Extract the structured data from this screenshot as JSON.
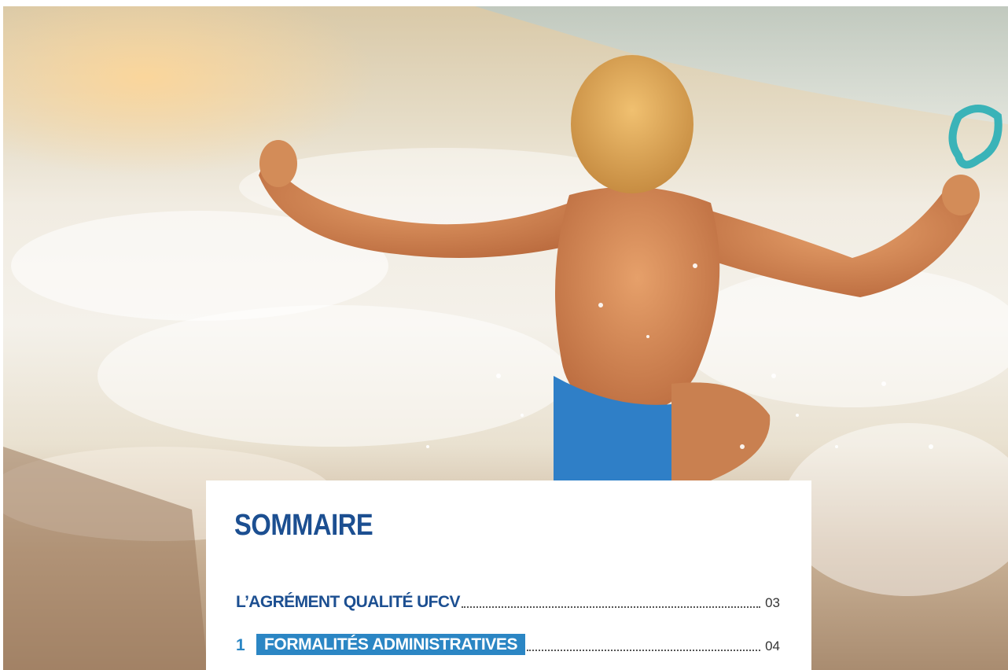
{
  "toc": {
    "title": "SOMMAIRE",
    "entries": [
      {
        "number": "",
        "label": "L’AGRÉMENT QUALITÉ UFCV",
        "page": "03"
      },
      {
        "number": "1",
        "label": "FORMALITÉS ADMINISTRATIVES",
        "page": "04"
      }
    ]
  },
  "colors": {
    "title": "#1c4f91",
    "accent": "#2b86c4",
    "text": "#333333"
  }
}
